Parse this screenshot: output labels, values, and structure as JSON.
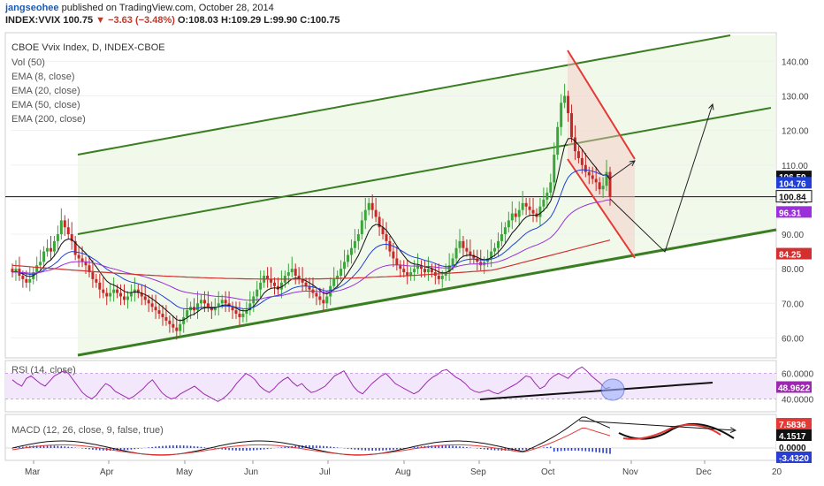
{
  "header": {
    "author": "jangseohee",
    "published_text": "published on TradingView.com, October 28, 2014",
    "symbol": "INDEX:VVIX",
    "last": "100.75",
    "change": "▼ −3.63 (−3.48%)",
    "open_label": "O:",
    "open": "108.03",
    "high_label": "H:",
    "high": "109.29",
    "low_label": "L:",
    "low": "99.90",
    "close_label": "C:",
    "close": "100.75"
  },
  "legend": {
    "title": "CBOE Vvix Index, D, INDEX-CBOE",
    "vol": "Vol (50)",
    "ema8": "EMA (8, close)",
    "ema20": "EMA (20, close)",
    "ema50": "EMA (50, close)",
    "ema200": "EMA (200, close)"
  },
  "colors": {
    "up": "#3aa63a",
    "down": "#c62828",
    "ema8": "#111111",
    "ema20": "#1f3fd6",
    "ema50": "#9b30d9",
    "ema200": "#d32f2f",
    "channel": "#3a7d22",
    "channel_fill": "#eef7e6",
    "rsi_line": "#9c27b0",
    "rsi_fill": "#f3e8fb",
    "macd_line": "#111111",
    "signal_line": "#e53935",
    "histogram": "#2a3fd1"
  },
  "chart_data": [
    {
      "type": "candlestick",
      "title": "CBOE Vvix Index, D, INDEX-CBOE",
      "x_tick_labels": [
        "Mar",
        "Apr",
        "May",
        "Jun",
        "Jul",
        "Aug",
        "Sep",
        "Oct",
        "Nov",
        "Dec",
        "20"
      ],
      "y_ticks": [
        60,
        70,
        80,
        90,
        100,
        110,
        120,
        130,
        140
      ],
      "y_tick_labels": [
        "60.00",
        "70.00",
        "80.00",
        "90.00",
        "100.00",
        "110.00",
        "120.00",
        "130.00",
        "140.00"
      ],
      "ylim": [
        55,
        147
      ],
      "candles_close_approx": [
        79,
        80,
        78,
        77,
        76,
        77,
        79,
        81,
        82,
        85,
        86,
        85,
        88,
        90,
        94,
        92,
        90,
        88,
        84,
        83,
        82,
        81,
        79,
        77,
        76,
        74,
        73,
        72,
        73,
        74,
        73,
        72,
        71,
        72,
        73,
        74,
        73,
        72,
        71,
        70,
        69,
        68,
        67,
        66,
        65,
        64,
        63,
        62,
        64,
        66,
        68,
        69,
        68,
        70,
        71,
        70,
        69,
        68,
        69,
        70,
        71,
        70,
        69,
        68,
        67,
        66,
        67,
        68,
        70,
        72,
        74,
        76,
        78,
        77,
        76,
        75,
        74,
        76,
        78,
        79,
        80,
        78,
        77,
        76,
        75,
        74,
        73,
        72,
        71,
        70,
        72,
        75,
        77,
        78,
        80,
        82,
        84,
        86,
        88,
        90,
        94,
        97,
        99,
        97,
        95,
        92,
        90,
        88,
        85,
        83,
        81,
        80,
        79,
        78,
        79,
        80,
        81,
        80,
        79,
        80,
        79,
        78,
        77,
        78,
        79,
        81,
        83,
        86,
        88,
        86,
        85,
        84,
        83,
        82,
        81,
        82,
        83,
        85,
        86,
        88,
        90,
        92,
        94,
        96,
        95,
        97,
        99,
        98,
        97,
        96,
        95,
        98,
        100,
        102,
        105,
        113,
        121,
        128,
        130,
        125,
        118,
        114,
        112,
        110,
        108,
        107,
        106,
        105,
        103,
        104,
        108,
        100.75
      ],
      "price_labels": [
        {
          "value": "106.59",
          "price": 106.59,
          "color": "#111111",
          "text_color": "#ffffff"
        },
        {
          "value": "104.76",
          "price": 104.76,
          "color": "#1f3fd6",
          "text_color": "#ffffff"
        },
        {
          "value": "100.84",
          "price": 100.84,
          "color": "#ffffff",
          "text_color": "#111111"
        },
        {
          "value": "96.31",
          "price": 96.31,
          "color": "#9b30d9",
          "text_color": "#ffffff"
        },
        {
          "value": "84.25",
          "price": 84.25,
          "color": "#d32f2f",
          "text_color": "#ffffff"
        }
      ],
      "series": [
        {
          "name": "EMA (8, close)"
        },
        {
          "name": "EMA (20, close)"
        },
        {
          "name": "EMA (50, close)"
        },
        {
          "name": "EMA (200, close)"
        }
      ],
      "horizontal_line": 100.84
    },
    {
      "type": "line",
      "title": "RSI (14, close)",
      "y_ticks": [
        40,
        60
      ],
      "y_tick_labels": [
        "40.0000",
        "60.0000"
      ],
      "ylim": [
        32,
        68
      ],
      "last_value": "48.9622",
      "values": [
        55,
        52,
        50,
        56,
        58,
        55,
        52,
        50,
        54,
        58,
        60,
        62,
        60,
        55,
        50,
        45,
        42,
        40,
        43,
        48,
        52,
        50,
        46,
        44,
        42,
        40,
        42,
        45,
        48,
        52,
        55,
        50,
        45,
        42,
        40,
        41,
        44,
        46,
        48,
        50,
        47,
        44,
        42,
        40,
        38,
        40,
        43,
        47,
        52,
        56,
        60,
        58,
        55,
        50,
        47,
        45,
        48,
        52,
        55,
        57,
        53,
        50,
        52,
        48,
        45,
        46,
        48,
        50,
        54,
        58,
        60,
        62,
        56,
        50,
        46,
        44,
        48,
        52,
        55,
        58,
        60,
        56,
        52,
        50,
        48,
        46,
        44,
        46,
        50,
        54,
        57,
        59,
        62,
        63,
        60,
        57,
        55,
        52,
        48,
        46,
        45,
        46,
        47,
        45,
        44,
        46,
        48,
        50,
        52,
        55,
        58,
        57,
        52,
        48,
        50,
        55,
        58,
        60,
        58,
        56,
        60,
        63,
        65,
        62,
        58,
        55,
        52,
        48,
        49
      ],
      "ellipse_annotation": true
    },
    {
      "type": "line",
      "title": "MACD (12, 26, close, 9, false, true)",
      "y_ticks": [
        0
      ],
      "last_values": [
        "7.5836",
        "4.1517",
        "0.0000",
        "-3.4320"
      ]
    }
  ]
}
